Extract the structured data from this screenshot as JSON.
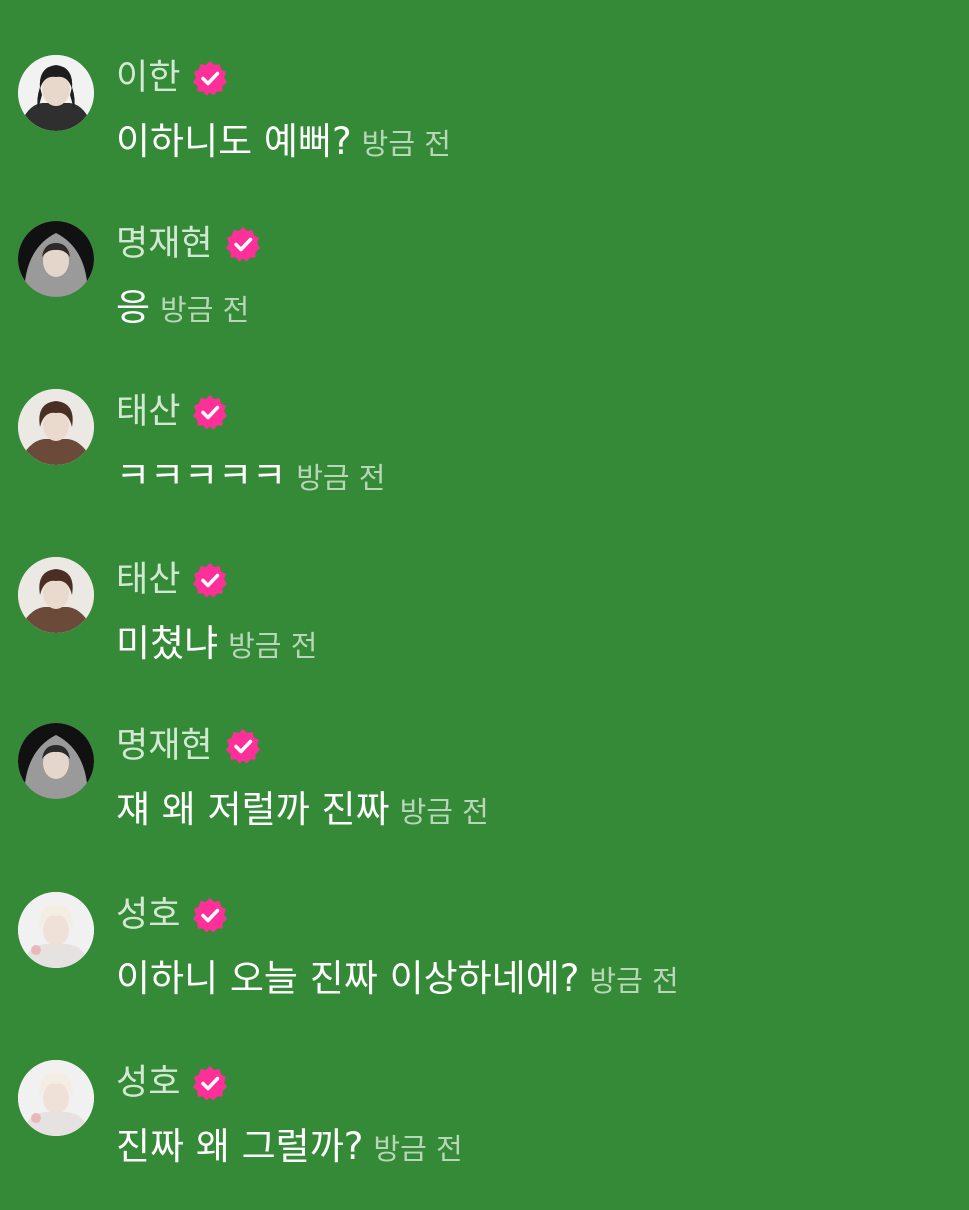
{
  "comments": [
    {
      "name": "이한",
      "message": "이하니도 예뻐?",
      "time": "방금 전",
      "avatar": "dark-hair"
    },
    {
      "name": "명재현",
      "message": "응",
      "time": "방금 전",
      "avatar": "hood"
    },
    {
      "name": "태산",
      "message": "ㅋㅋㅋㅋㅋ",
      "time": "방금 전",
      "avatar": "brown-hair"
    },
    {
      "name": "태산",
      "message": "미쳤냐",
      "time": "방금 전",
      "avatar": "brown-hair"
    },
    {
      "name": "명재현",
      "message": "쟤 왜 저럴까 진짜",
      "time": "방금 전",
      "avatar": "hood"
    },
    {
      "name": "성호",
      "message": "이하니 오늘 진짜 이상하네에?",
      "time": "방금 전",
      "avatar": "blonde"
    },
    {
      "name": "성호",
      "message": "진짜 왜 그럴까?",
      "time": "방금 전",
      "avatar": "blonde"
    }
  ],
  "colors": {
    "background": "#348a36",
    "badge": "#ff2f9a",
    "name": "#d3e8d3",
    "message": "#ffffff",
    "time": "#b9d6b9"
  },
  "icons": {
    "badge": "verified-badge-icon"
  }
}
